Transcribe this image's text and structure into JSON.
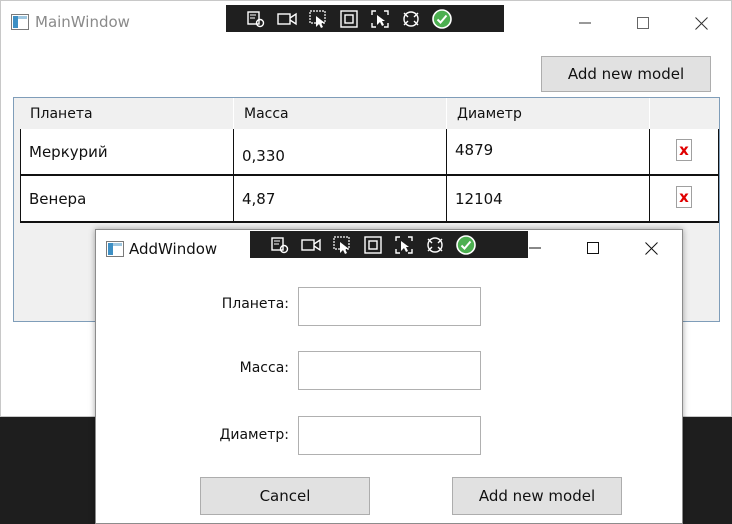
{
  "main_window": {
    "title": "MainWindow",
    "add_button_label": "Add new model",
    "grid": {
      "columns": [
        "Планета",
        "Масса",
        "Диаметр",
        ""
      ],
      "rows": [
        {
          "planet": "Меркурий",
          "mass": "0,330",
          "diameter": "4879",
          "delete_label": "x"
        },
        {
          "planet": "Венера",
          "mass": "4,87",
          "diameter": "12104",
          "delete_label": "x"
        }
      ]
    }
  },
  "add_window": {
    "title": "AddWindow",
    "fields": [
      {
        "label": "Планета:",
        "value": ""
      },
      {
        "label": "Масса:",
        "value": ""
      },
      {
        "label": "Диаметр:",
        "value": ""
      }
    ],
    "cancel_label": "Cancel",
    "add_label": "Add new model"
  },
  "dev_toolbar": {
    "tools": [
      "select-element-icon",
      "record-icon",
      "pointer-select-icon",
      "frame-icon",
      "track-focus-icon",
      "hot-reload-icon",
      "check-icon"
    ]
  },
  "colors": {
    "delete_x": "#e00000",
    "check_green": "#4caf50",
    "button_bg": "#e1e1e1",
    "grid_bg": "#f0f0f0"
  }
}
